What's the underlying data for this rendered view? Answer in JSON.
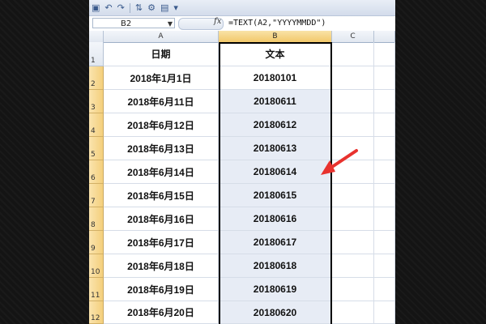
{
  "formula_bar": {
    "name_box": "B2",
    "fx_label": "fx",
    "formula": "=TEXT(A2,\"YYYYMMDD\")"
  },
  "columns": [
    "A",
    "B",
    "C"
  ],
  "header_row": {
    "row_number": "1",
    "col_a": "日期",
    "col_b": "文本"
  },
  "rows": [
    {
      "row_number": "2",
      "date": "2018年1月1日",
      "text": "20180101"
    },
    {
      "row_number": "3",
      "date": "2018年6月11日",
      "text": "20180611"
    },
    {
      "row_number": "4",
      "date": "2018年6月12日",
      "text": "20180612"
    },
    {
      "row_number": "5",
      "date": "2018年6月13日",
      "text": "20180613"
    },
    {
      "row_number": "6",
      "date": "2018年6月14日",
      "text": "20180614"
    },
    {
      "row_number": "7",
      "date": "2018年6月15日",
      "text": "20180615"
    },
    {
      "row_number": "8",
      "date": "2018年6月16日",
      "text": "20180616"
    },
    {
      "row_number": "9",
      "date": "2018年6月17日",
      "text": "20180617"
    },
    {
      "row_number": "10",
      "date": "2018年6月18日",
      "text": "20180618"
    },
    {
      "row_number": "11",
      "date": "2018年6月19日",
      "text": "20180619"
    },
    {
      "row_number": "12",
      "date": "2018年6月20日",
      "text": "20180620"
    }
  ],
  "colors": {
    "selection_fill": "#e7ecf5",
    "row_header_selected": "#f4cf7c",
    "arrow": "#e8322e"
  },
  "icons": [
    "save-icon",
    "undo-icon",
    "redo-icon",
    "sort-icon",
    "filter-icon",
    "chart-icon"
  ]
}
